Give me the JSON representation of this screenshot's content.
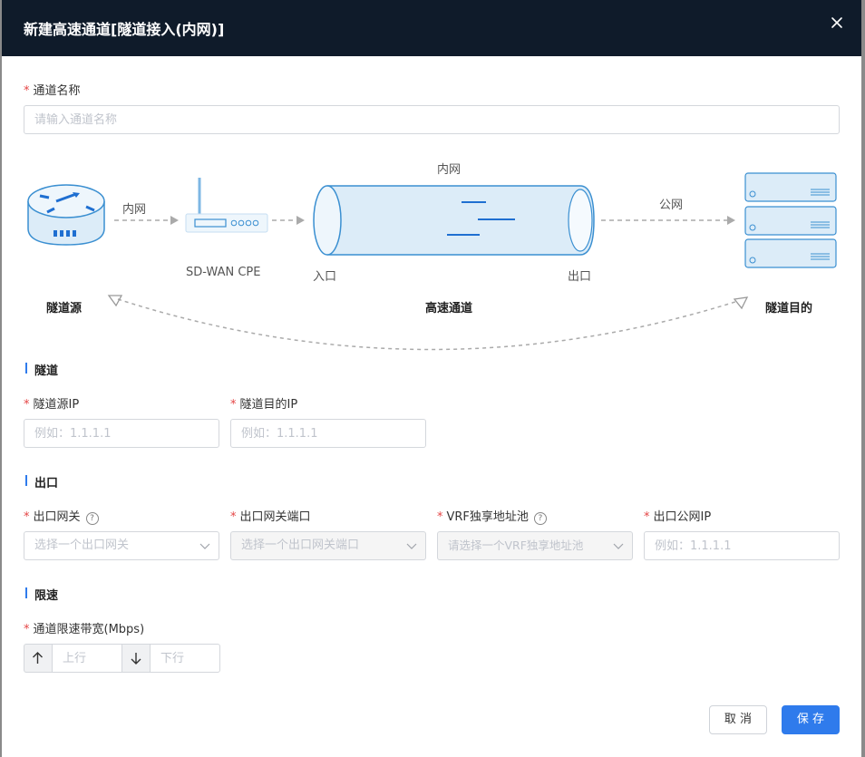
{
  "dialog": {
    "title": "新建高速通道[隧道接入(内网)]"
  },
  "channel_name": {
    "label": "通道名称",
    "placeholder": "请输入通道名称"
  },
  "diagram": {
    "intranet_top": "内网",
    "intranet_left": "内网",
    "public_net": "公网",
    "cpe_label": "SD-WAN CPE",
    "entry": "入口",
    "exit": "出口",
    "tunnel_source": "隧道源",
    "high_speed_channel": "高速通道",
    "tunnel_destination": "隧道目的"
  },
  "tunnel_section": {
    "title": "隧道",
    "source_ip": {
      "label": "隧道源IP",
      "placeholder": "例如：1.1.1.1"
    },
    "dest_ip": {
      "label": "隧道目的IP",
      "placeholder": "例如：1.1.1.1"
    }
  },
  "exit_section": {
    "title": "出口",
    "gateway": {
      "label": "出口网关",
      "placeholder": "选择一个出口网关"
    },
    "gateway_port": {
      "label": "出口网关端口",
      "placeholder": "选择一个出口网关端口"
    },
    "vrf_pool": {
      "label": "VRF独享地址池",
      "placeholder": "请选择一个VRF独享地址池"
    },
    "public_ip": {
      "label": "出口公网IP",
      "placeholder": "例如：1.1.1.1"
    }
  },
  "rate_section": {
    "title": "限速",
    "bandwidth": {
      "label": "通道限速带宽(Mbps)",
      "up_placeholder": "上行",
      "down_placeholder": "下行"
    }
  },
  "footer": {
    "cancel": "取 消",
    "save": "保 存"
  },
  "colors": {
    "header_bg": "#0f1b2a",
    "accent": "#2f7bec",
    "required": "#e54545"
  }
}
